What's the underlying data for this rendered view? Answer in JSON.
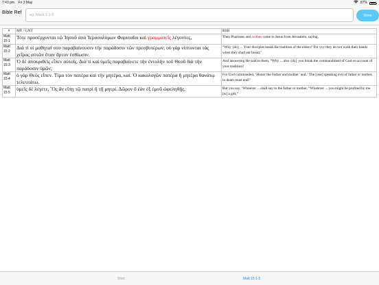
{
  "status_bar": {
    "time": "7:43 pm",
    "date": "Fri 3 May",
    "battery_text": "87%",
    "battery_level": 0.87
  },
  "nav": {
    "title": "Bible Ref",
    "search_placeholder": "eg. Mark 1:1-5",
    "go_label": "Done"
  },
  "table": {
    "headers": {
      "ref": "#",
      "source": "MT / GNT",
      "translation": "BSB"
    },
    "rows": [
      {
        "ref_book": "Matt",
        "ref_verse": "15:1",
        "greek_before": "Τότε προσέρχονται τῷ Ἰησοῦ ἀπὸ Ἱεροσολύμων Φαρισαῖοι καὶ ",
        "greek_red": "γραμματεῖς",
        "greek_after": " λέγοντες,",
        "english_before": "Then Pharisees and ",
        "english_red": "scribes",
        "english_after": " come to Jesus from Jerusalem, saying,"
      },
      {
        "ref_book": "Matt",
        "ref_verse": "15:2",
        "greek": "Διὰ τί οἱ μαθηταί σου παραβαίνουσιν τὴν παράδοσιν τῶν πρεσβυτέρων; οὐ γὰρ νίπτονται τὰς χεῖρας αὐτῶν ὅταν ἄρτον ἐσθίωσιν.",
        "english": "“Why {do} ... Your disciples break the tradition of the elders? For vvv they do not wash their hands when they shall eat bread.”"
      },
      {
        "ref_book": "Matt",
        "ref_verse": "15:3",
        "greek": "Ὁ δὲ ἀποκριθεὶς εἶπεν αὐτοῖς. Διὰ τί καὶ ὑμεῖς παραβαίνετε τὴν ἐντολὴν τοῦ Θεοῦ διὰ τὴν παράδοσιν ὑμῶν;",
        "english": "And answering He said to them, “Why ... also {do} you break the commandment of God on account of your tradition?"
      },
      {
        "ref_book": "Matt",
        "ref_verse": "15:4",
        "greek": "ὁ γὰρ Θεὸς εἶπεν. Τίμα τὸν πατέρα καὶ τὴν μητέρα, καί. Ὁ κακολογῶν πατέρα ἢ μητέρα θανάτῳ τελευτάτω.",
        "english": "For God commanded, ‘Honor the Father and mother’ and, ‘The [one] speaking evil of father or mother, in death must end!’"
      },
      {
        "ref_book": "Matt",
        "ref_verse": "15:5",
        "greek": "ὑμεῖς δὲ λέγετε, Ὃς ἂν εἴπῃ τῷ πατρὶ ἢ τῇ μητρί. Δῶρον ὃ ἐὰν ἐξ ἐμοῦ ὠφεληθῇς,",
        "english": "But you say, ‘Whoever ... shall say to the father or mother, “Whatever ... you might be profited by me [is] a gift,”"
      }
    ]
  },
  "toolbar": {
    "start_label": "Start",
    "range_label": "Matt 15:1-5"
  },
  "colors": {
    "accent": "#5ac8fa",
    "link": "#1a8ff0",
    "highlight": "#d0021b"
  }
}
